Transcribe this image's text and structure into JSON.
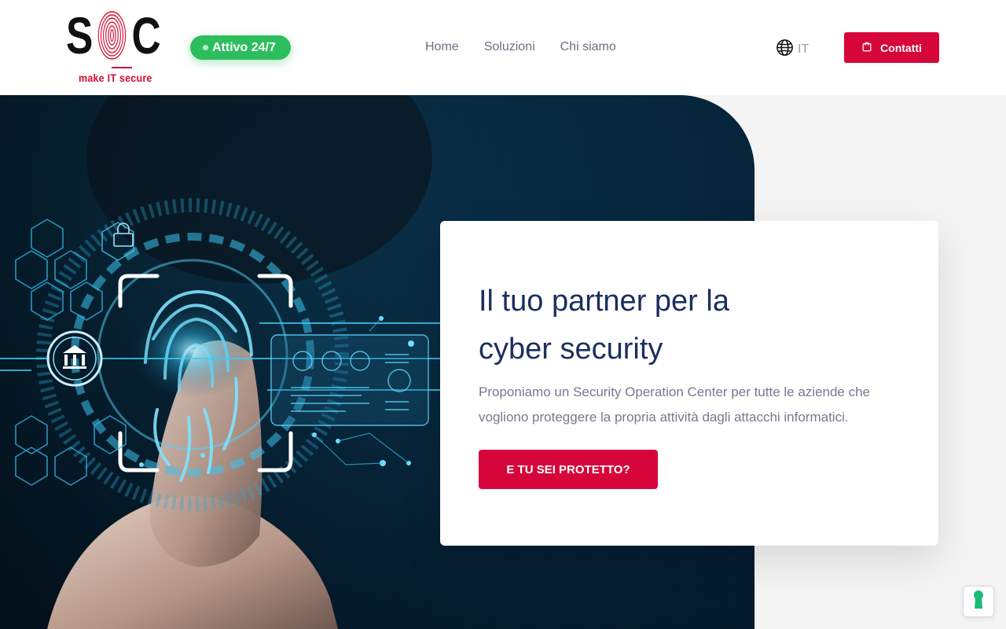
{
  "brand": {
    "logo_letters": "SOC",
    "tagline": "make IT secure",
    "accent_color": "#d7063a"
  },
  "status": {
    "label": "Attivo 24/7",
    "color": "#2cbe5d"
  },
  "nav": {
    "items": [
      {
        "label": "Home"
      },
      {
        "label": "Soluzioni"
      },
      {
        "label": "Chi siamo"
      }
    ]
  },
  "language": {
    "icon": "globe-icon",
    "code": "IT"
  },
  "contact_button": {
    "icon": "shopping-bag-icon",
    "label": "Contatti"
  },
  "hero": {
    "image": "fingerprint-touch-cyber-security",
    "title_line1": "Il tuo partner per la",
    "title_line2": "cyber security",
    "description": "Proponiamo un Security Operation Center per tutte le aziende che vogliono proteggere la propria attività dagli attacchi informatici.",
    "cta_label": "E TU SEI PROTETTO?"
  },
  "floating_widget": {
    "icon": "keyhole-icon",
    "color": "#1dbb76"
  }
}
